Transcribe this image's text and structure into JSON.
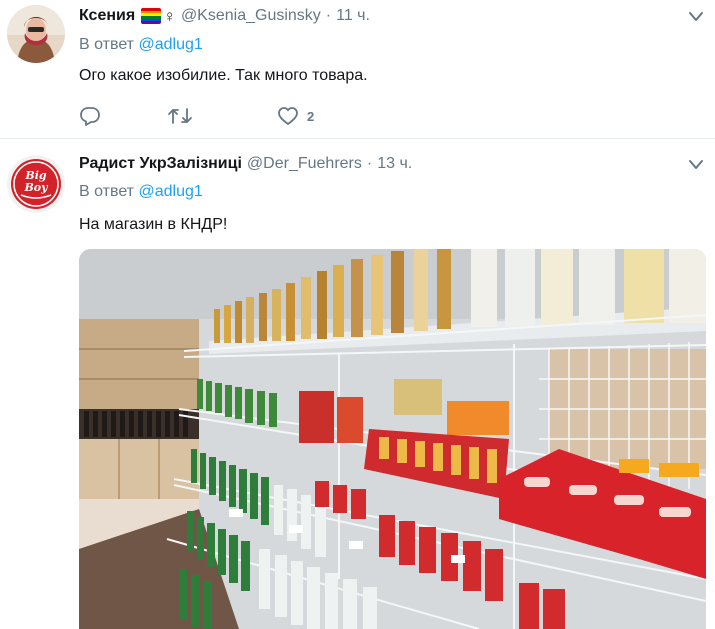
{
  "tweets": [
    {
      "name": "Ксения",
      "handle": "@Ksenia_Gusinsky",
      "separator": "·",
      "time": "11 ч.",
      "reply_prefix": "В ответ",
      "reply_to": "@adlug1",
      "text": "Ого какое изобилие. Так много товара.",
      "like_count": "2",
      "name_emoji_icons": [
        "rainbow-flag-icon",
        "female-sign-icon"
      ],
      "female_sign": "♀"
    },
    {
      "name": "Радист УкрЗалізниці",
      "handle": "@Der_Fuehrers",
      "separator": "·",
      "time": "13 ч.",
      "reply_prefix": "В ответ",
      "reply_to": "@adlug1",
      "text": "На магазин в КНДР!",
      "avatar_logo_text": "Big Boy"
    }
  ],
  "icons": {
    "caret": "chevron-down-icon",
    "reply": "reply-icon",
    "retweet": "retweet-icon",
    "like": "heart-icon"
  },
  "colors": {
    "link": "#1da1f2",
    "secondary_text": "#657786",
    "primary_text": "#14171a",
    "divider": "#e6ecf0"
  }
}
